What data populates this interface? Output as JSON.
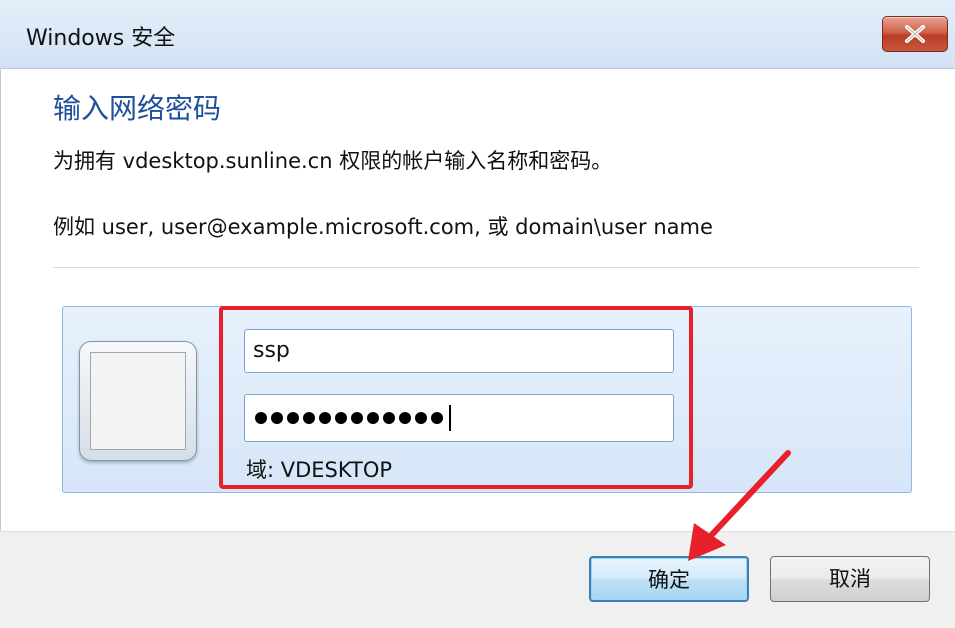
{
  "window": {
    "title": "Windows 安全"
  },
  "dialog": {
    "heading": "输入网络密码",
    "description": "为拥有 vdesktop.sunline.cn 权限的帐户输入名称和密码。",
    "example": "例如 user, user@example.microsoft.com, 或 domain\\user name"
  },
  "credentials": {
    "username_value": "ssp",
    "password_masked": "••••••••••••",
    "password_length": 12,
    "domain_label": "域: VDESKTOP"
  },
  "buttons": {
    "ok_label": "确定",
    "cancel_label": "取消"
  },
  "annotation": {
    "highlight_color": "#e8202a"
  },
  "colors": {
    "heading": "#1e4f9a",
    "titlebar": "#d2e2f4",
    "close_button": "#c9573f"
  }
}
